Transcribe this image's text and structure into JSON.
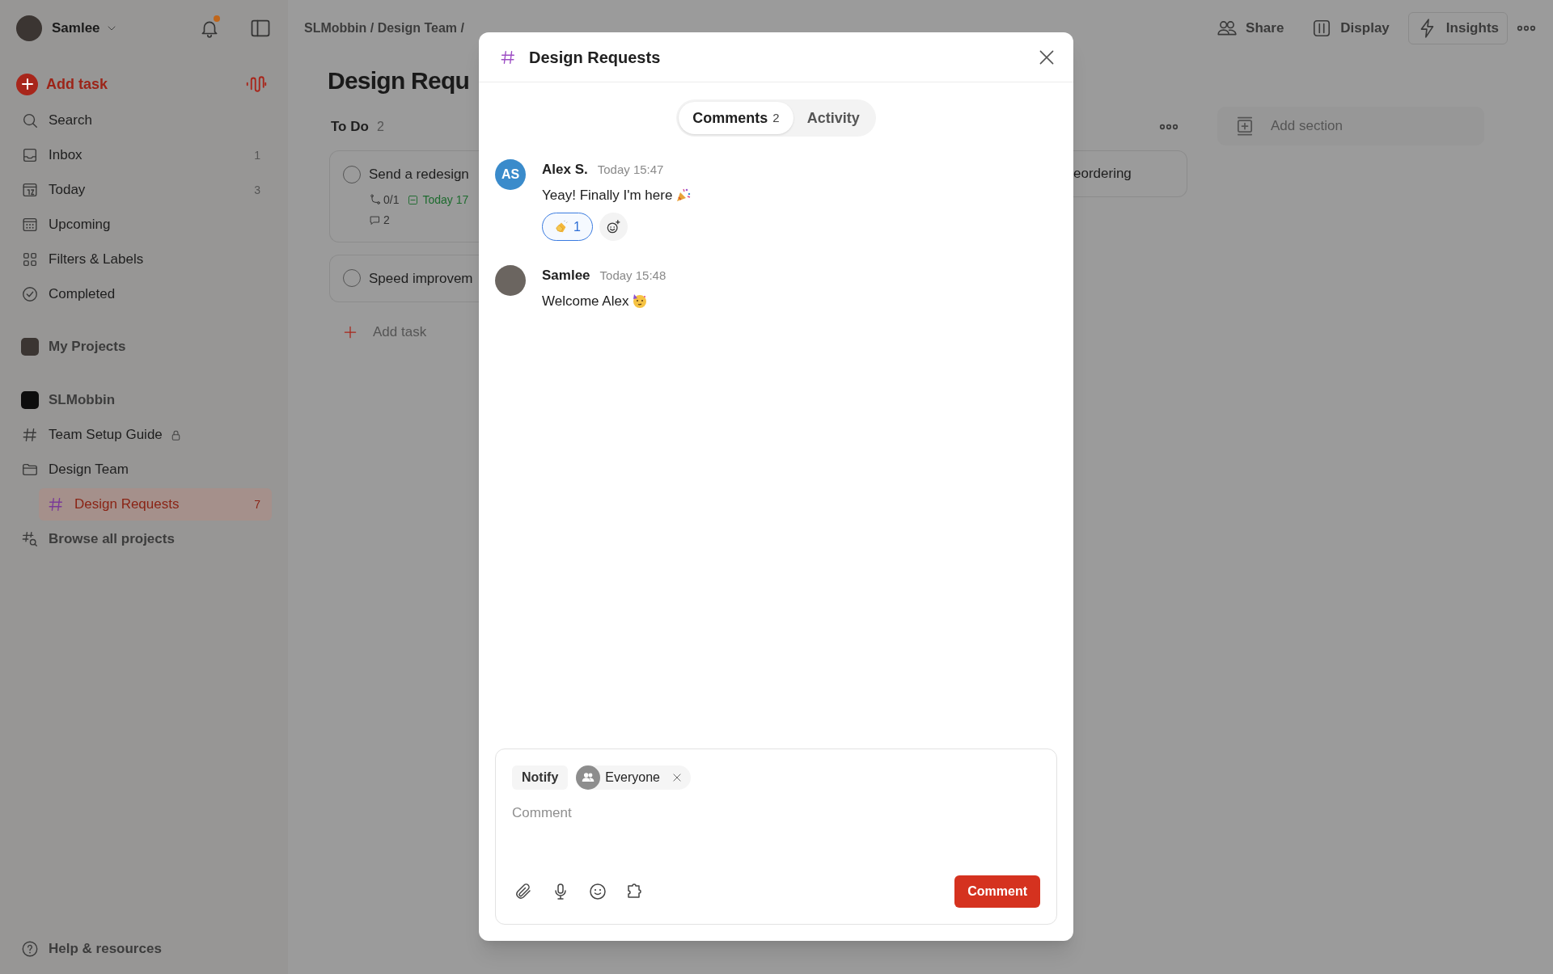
{
  "sidebar": {
    "user": {
      "name": "Samlee"
    },
    "notifications_unread": true,
    "add_task": "Add task",
    "nav": [
      {
        "label": "Search",
        "selected": false
      },
      {
        "label": "Inbox",
        "count": "1",
        "selected": false
      },
      {
        "label": "Today",
        "count": "3",
        "selected": false
      },
      {
        "label": "Upcoming",
        "selected": false
      },
      {
        "label": "Filters & Labels",
        "selected": false
      },
      {
        "label": "Completed",
        "selected": false
      }
    ],
    "my_projects": "My Projects",
    "workspace": "SLMobbin",
    "projects": [
      {
        "kind": "project",
        "label": "Team Setup Guide",
        "locked": true,
        "selected": false
      },
      {
        "kind": "folder",
        "label": "Design Team",
        "selected": false,
        "children": [
          {
            "kind": "project",
            "label": "Design Requests",
            "count": "7",
            "selected": true
          }
        ]
      }
    ],
    "browse": "Browse all projects",
    "help": "Help & resources"
  },
  "main": {
    "breadcrumb": "SLMobbin / Design Team /",
    "title": "Design Requ",
    "toolbar": [
      {
        "label": "Share",
        "active": false
      },
      {
        "label": "Display",
        "active": false
      },
      {
        "label": "Insights",
        "active": true
      }
    ],
    "columns": [
      {
        "title": "To Do",
        "count": "2",
        "tasks": [
          {
            "title": "Send a redesign",
            "checked": false,
            "subtasks": "0/1",
            "due": "Today 17",
            "comments": "2"
          },
          {
            "title": "Speed improvem",
            "checked": false
          }
        ],
        "add_task": "Add task"
      },
      {
        "tasks": [
          {
            "title": "eordering"
          }
        ]
      }
    ],
    "add_section": "Add section"
  },
  "modal": {
    "title": "Design Requests",
    "tabs": [
      {
        "label": "Comments",
        "count": "2",
        "selected": true
      },
      {
        "label": "Activity",
        "selected": false
      }
    ],
    "comments": [
      {
        "author": "Alex S.",
        "kind": "initials",
        "initials": "AS",
        "time": "Today 15:47",
        "text": "Yeay! Finally I'm here",
        "reactions": [
          {
            "count": "1",
            "reacted": true
          }
        ]
      },
      {
        "author": "Samlee",
        "kind": "photo",
        "time": "Today 15:48",
        "text": "Welcome Alex"
      }
    ],
    "composer": {
      "notify": "Notify",
      "recipient": "Everyone",
      "placeholder": "Comment",
      "submit": "Comment"
    }
  }
}
